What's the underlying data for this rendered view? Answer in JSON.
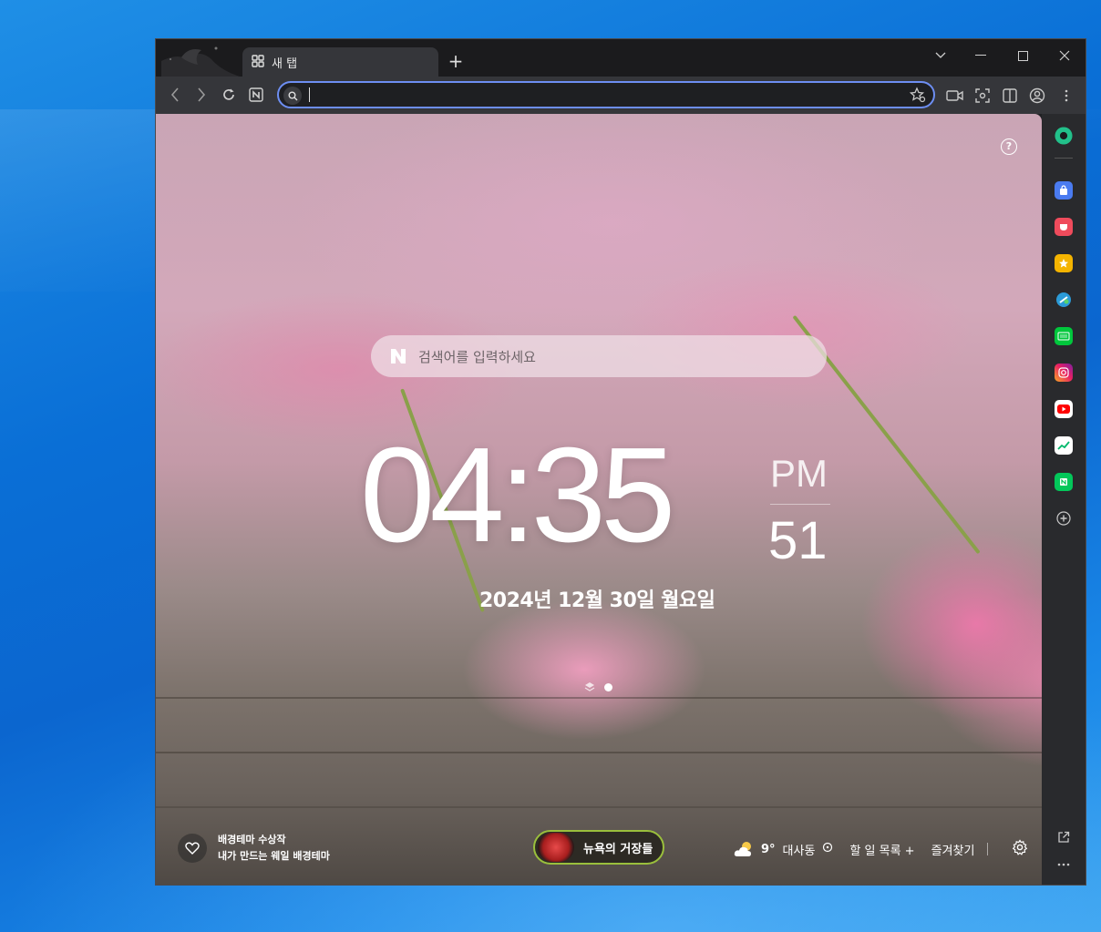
{
  "browser": {
    "tab": {
      "title": "새 탭"
    },
    "new_tab_symbol": "+"
  },
  "omnibox": {
    "value": ""
  },
  "newtab": {
    "search": {
      "placeholder": "검색어를 입력하세요",
      "logo": "N"
    },
    "clock": {
      "time": "04:35",
      "ampm": "PM",
      "seconds": "51",
      "date": "2024년 12월 30일 월요일"
    },
    "help": "?",
    "theme": {
      "line1": "배경테마 수상작",
      "line2": "내가 만드는 웨일 배경테마"
    },
    "news": {
      "label": "뉴욕의 거장들"
    },
    "weather": {
      "temp": "9°",
      "location": "대사동"
    },
    "todo": {
      "label": "할 일 목록 +"
    },
    "bookmarks": {
      "label": "즐겨찾기"
    }
  },
  "sidebar": {
    "items": [
      "green-app-icon",
      "shopping-icon",
      "pocket-icon",
      "favorites-star-icon",
      "translate-icon",
      "webtoon-icon",
      "instagram-icon",
      "youtube-icon",
      "stock-icon",
      "naver-news-icon",
      "add-icon"
    ]
  },
  "colors": {
    "accent": "#6d8ef2",
    "news_border": "#9abf3c"
  }
}
